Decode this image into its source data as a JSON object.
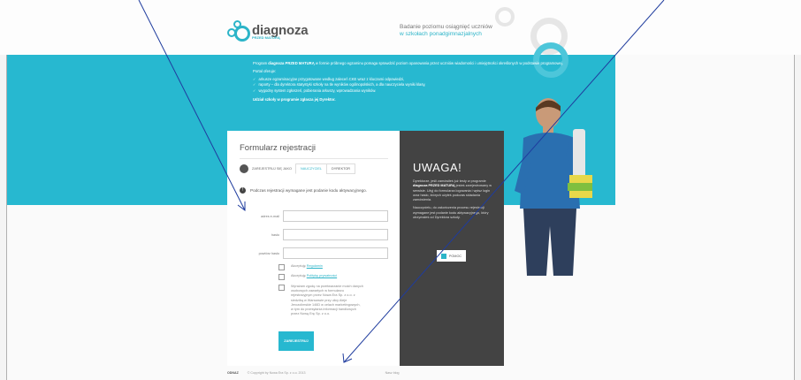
{
  "header": {
    "logo_text": "diagnoza",
    "logo_sub": "PRZED MATURĄ",
    "tagline_line1": "Badanie poziomu osiągnięć uczniów",
    "tagline_line2": "w szkołach ponadgimnazjalnych"
  },
  "banner": {
    "intro_part1": "Program ",
    "intro_brand": "diagnoza PRZED MATURĄ",
    "intro_part2": " w formie próbnego egzaminu pomaga sprawdzić poziom opanowania przez uczniów wiadomości i umiejętności określonych w podstawie programowej.",
    "portal_label": "Portal oferuje:",
    "items": [
      "arkusze egzaminacyjne przygotowane według zaleceń CKE wraz z kluczami odpowiedzi,",
      "raporty – dla dyrektora statystyki szkoły na tle wyników ogólnopolskich, a dla nauczyciela wyniki klasy,",
      "wygodny system zgłoszeń, pobierania arkuszy, wprowadzania wyników."
    ],
    "closing": "Udział szkoły w programie zgłasza jej Dyrektor."
  },
  "form": {
    "title": "Formularz rejestracji",
    "role_label": "ZAREJESTRUJ SIĘ JAKO",
    "tabs": [
      "NAUCZYCIEL",
      "DYREKTOR"
    ],
    "info_text": "Podczas rejestracji wymagane jest podanie kodu aktywacyjnego.",
    "email_label": "adres e-mail",
    "password_label": "hasło",
    "repeat_password_label": "powtórz hasło",
    "accept_prefix": "Akceptuję ",
    "regulations_link": "Regulamin",
    "privacy_link": "Politykę prywatności",
    "consent_text": "Wyrażam zgodę na przetwarzanie moich danych osobowych zawartych w formularzu rejestracyjnym przez Nowa Era Sp. z o.o. z siedzibą w Warszawie przy ulicy Aleje Jerozolimskie 146D w celach marketingowych, w tym do przesyłania informacji handlowych przez Nową Erę Sp. z o.o.",
    "submit_label": "ZAREJESTRUJ"
  },
  "uwaga": {
    "title": "UWAGA!",
    "p1_a": "Dyrektorze, jeśli zamówiłeś już testy w programie ",
    "p1_brand": "diagnoza PRZED MATURĄ",
    "p1_b": " jesteś zarejestrowany w serwisie. Użyj do formularza logowania i wpisz login oraz hasło, których użyłeś podczas składania zamówienia.",
    "p2": "Nauczycielu, do zakończenia procesu rejestracji wymagane jest podanie kodu aktywacyjnego, który otrzymałeś od Dyrektora szkoły.",
    "help_label": "POMOC"
  },
  "footer": {
    "brand": "ODNAZ",
    "copyright": "© Copyright by Nowa Era Sp. z o.o. 2013",
    "right": "Nasz blog"
  },
  "colors": {
    "accent": "#27b8d0",
    "dark_panel": "#434343",
    "annotation_line": "#1f3c9e"
  }
}
